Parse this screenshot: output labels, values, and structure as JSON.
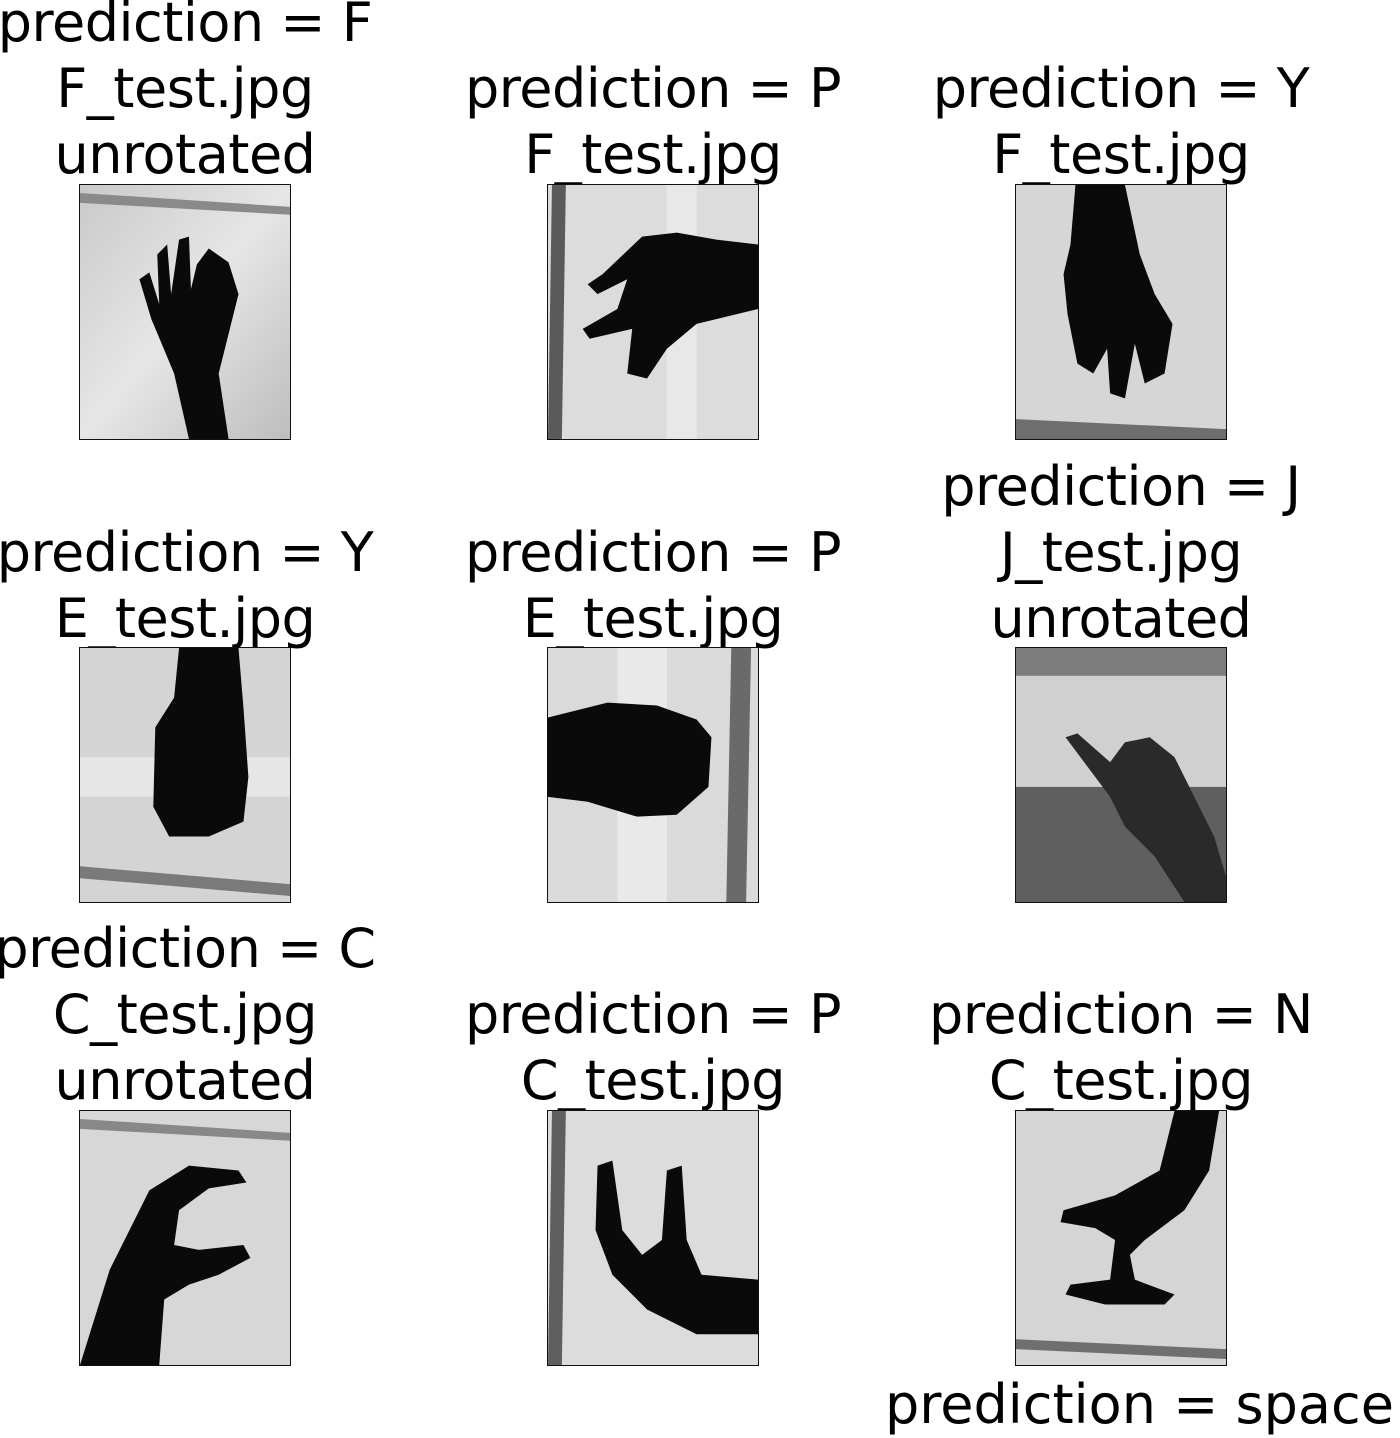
{
  "panels": [
    {
      "id": "p1",
      "lines": [
        "prediction = F",
        "F_test.jpg",
        "unrotated"
      ],
      "hand": "F-upright"
    },
    {
      "id": "p2",
      "lines": [
        "prediction = P",
        "F_test.jpg"
      ],
      "hand": "F-rotated-right"
    },
    {
      "id": "p3",
      "lines": [
        "prediction = Y",
        "F_test.jpg"
      ],
      "hand": "F-upside-down"
    },
    {
      "id": "p4",
      "lines": [
        "prediction = Y",
        "E_test.jpg"
      ],
      "hand": "E-upside-down"
    },
    {
      "id": "p5",
      "lines": [
        "prediction = P",
        "E_test.jpg"
      ],
      "hand": "E-rotated-right"
    },
    {
      "id": "p6",
      "lines": [
        "prediction = J",
        "J_test.jpg",
        "unrotated"
      ],
      "hand": "J-upright"
    },
    {
      "id": "p7",
      "lines": [
        "prediction = C",
        "C_test.jpg",
        "unrotated"
      ],
      "hand": "C-upright"
    },
    {
      "id": "p8",
      "lines": [
        "prediction = P",
        "C_test.jpg"
      ],
      "hand": "C-rotated-right"
    },
    {
      "id": "p9",
      "lines": [
        "prediction = N",
        "C_test.jpg"
      ],
      "hand": "C-upside-down"
    }
  ],
  "cut_off_title": "prediction = space"
}
